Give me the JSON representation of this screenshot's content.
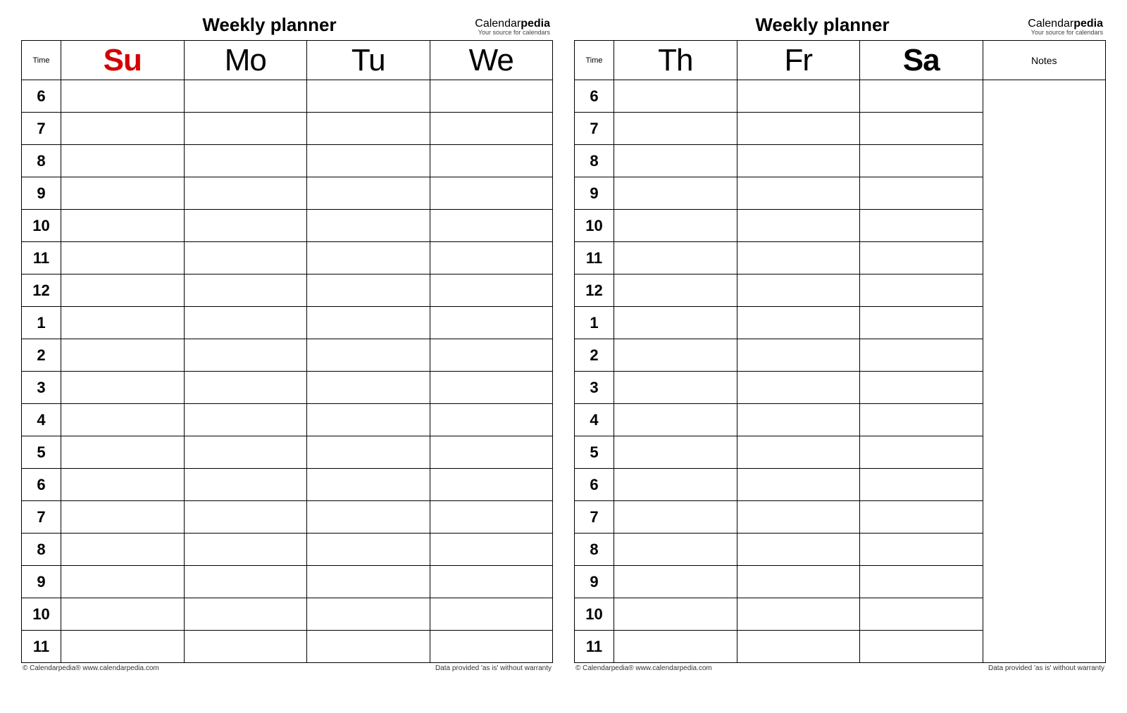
{
  "brand": {
    "name_a": "Calendar",
    "name_b": "pedia",
    "tagline": "Your source for calendars"
  },
  "footer": {
    "left": "© Calendarpedia®   www.calendarpedia.com",
    "right": "Data provided 'as is' without warranty"
  },
  "labels": {
    "title": "Weekly planner",
    "time": "Time",
    "notes": "Notes"
  },
  "hours": [
    "6",
    "7",
    "8",
    "9",
    "10",
    "11",
    "12",
    "1",
    "2",
    "3",
    "4",
    "5",
    "6",
    "7",
    "8",
    "9",
    "10",
    "11"
  ],
  "pages": [
    {
      "days": [
        {
          "abbr": "Su",
          "bold": true,
          "red": true
        },
        {
          "abbr": "Mo",
          "bold": false,
          "red": false
        },
        {
          "abbr": "Tu",
          "bold": false,
          "red": false
        },
        {
          "abbr": "We",
          "bold": false,
          "red": false
        }
      ],
      "notes_column": false
    },
    {
      "days": [
        {
          "abbr": "Th",
          "bold": false,
          "red": false
        },
        {
          "abbr": "Fr",
          "bold": false,
          "red": false
        },
        {
          "abbr": "Sa",
          "bold": true,
          "red": false
        }
      ],
      "notes_column": true
    }
  ]
}
